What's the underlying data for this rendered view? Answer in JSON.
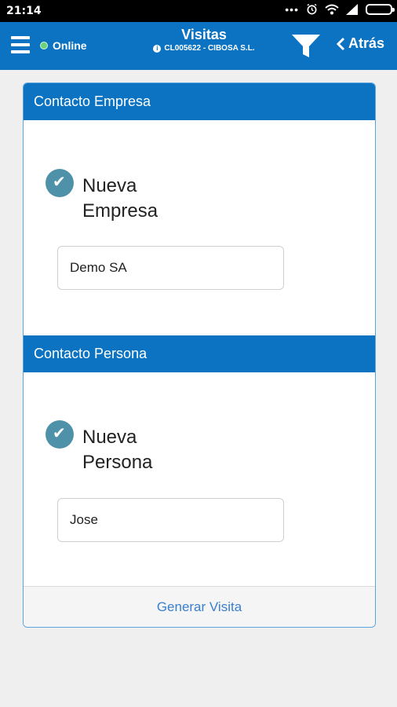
{
  "statusbar": {
    "time": "21:14",
    "dots": "•••"
  },
  "appbar": {
    "online_label": "Online",
    "title": "Visitas",
    "subtitle": "CL005622 - CIBOSA S.L.",
    "back_label": "Atrás"
  },
  "sections": {
    "empresa": {
      "header": "Contacto Empresa",
      "check_label": "Nueva Empresa",
      "field_value": "Demo SA"
    },
    "persona": {
      "header": "Contacto Persona",
      "check_label": "Nueva Persona",
      "field_value": "Jose"
    }
  },
  "footer": {
    "action_label": "Generar Visita"
  },
  "colors": {
    "primary": "#0b73c2",
    "check": "#4f91a8",
    "online": "#6fd07a",
    "link": "#3a7fce"
  },
  "icons": [
    "menu-icon",
    "online-status-icon",
    "info-icon",
    "filter-icon",
    "chevron-left-icon",
    "check-icon",
    "alarm-icon",
    "wifi-icon",
    "signal-icon",
    "battery-icon"
  ]
}
